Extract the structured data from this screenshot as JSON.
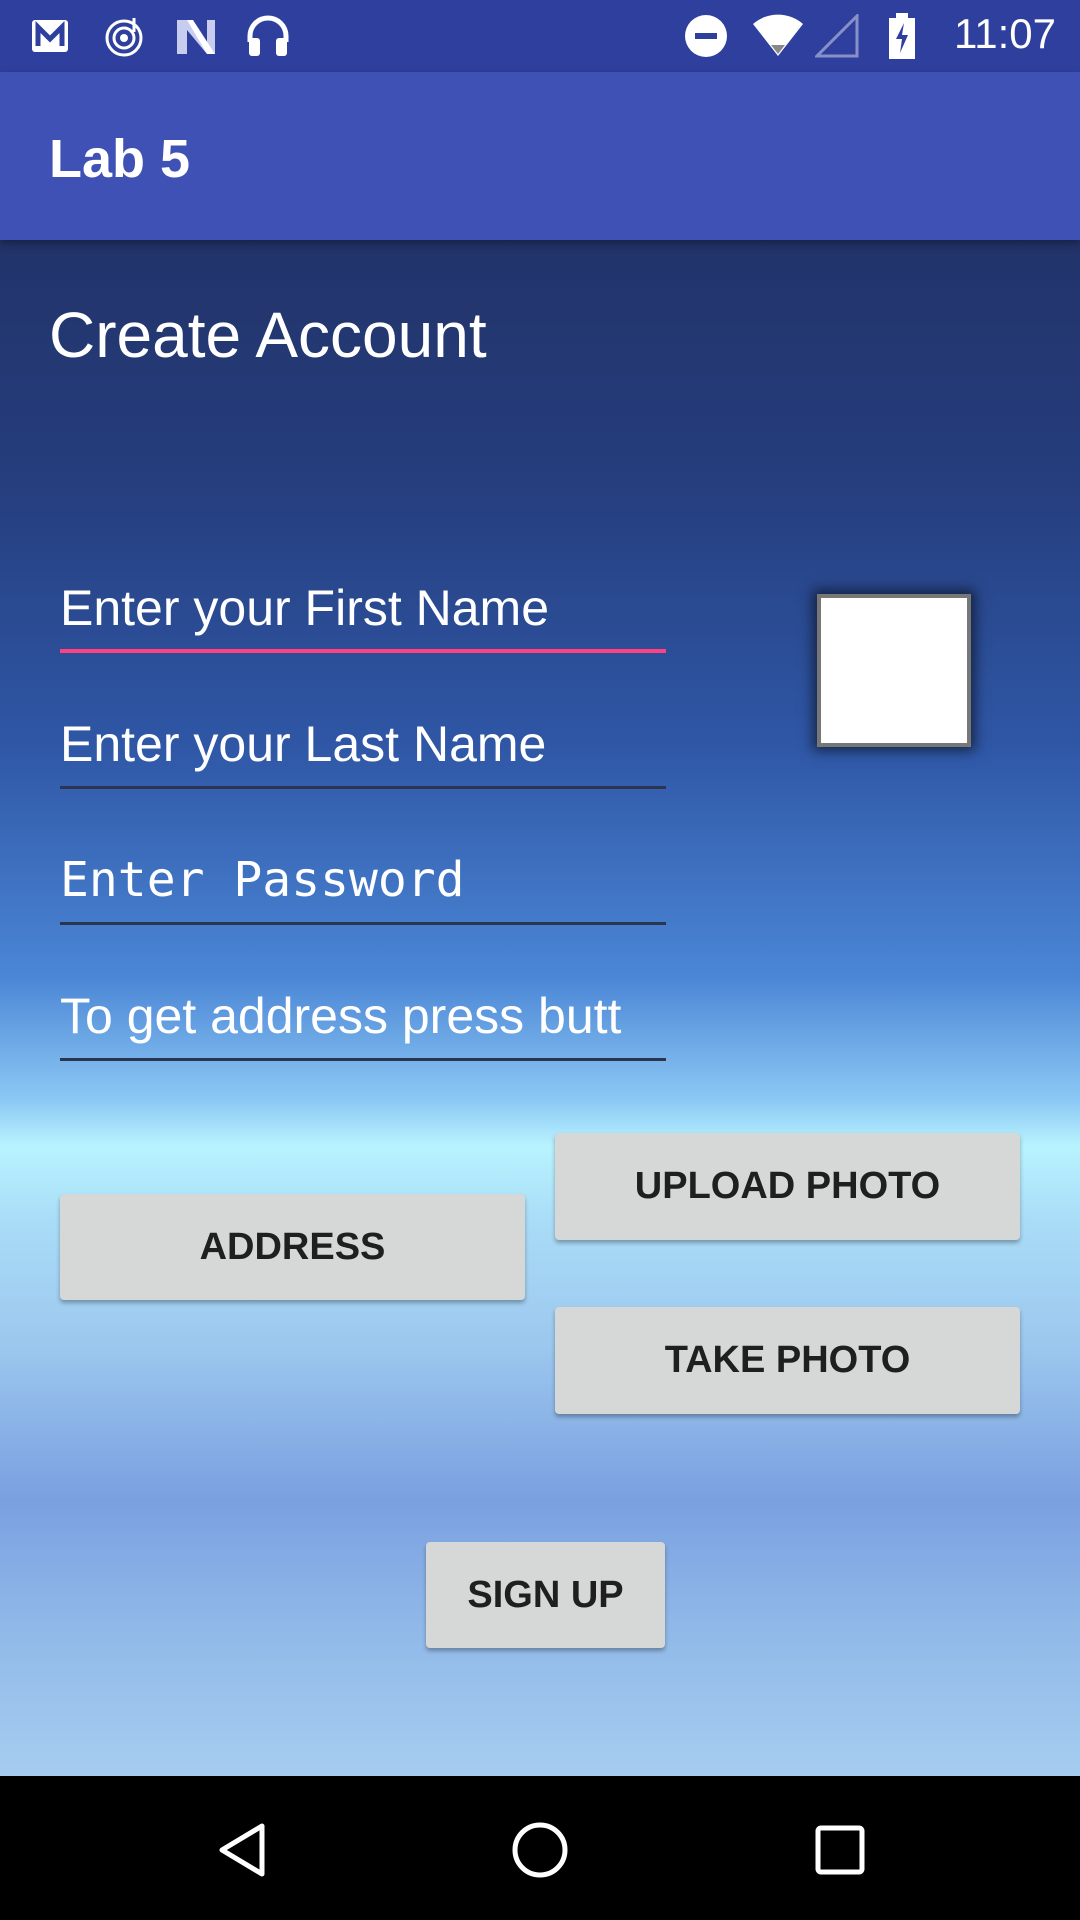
{
  "status_bar": {
    "time": "11:07",
    "left_icons": [
      "gmail-icon",
      "music-icon",
      "n-icon",
      "headphones-icon"
    ],
    "right_icons": [
      "do-not-disturb-icon",
      "wifi-icon",
      "cell-signal-icon",
      "battery-charging-icon"
    ],
    "color": "#2f3f9e"
  },
  "app_bar": {
    "title": "Lab 5",
    "color": "#3f51b5"
  },
  "form": {
    "heading": "Create Account",
    "first_name_hint": "Enter your First Name",
    "last_name_hint": "Enter your Last Name",
    "password_hint": "Enter Password",
    "address_hint": "To get address press butt",
    "accent_color": "#ff4081"
  },
  "buttons": {
    "upload_photo": "UPLOAD PHOTO",
    "address": "ADDRESS",
    "take_photo": "TAKE PHOTO",
    "sign_up": "SIGN UP"
  },
  "nav_bar": {
    "icons": [
      "back-icon",
      "home-icon",
      "recents-icon"
    ]
  }
}
